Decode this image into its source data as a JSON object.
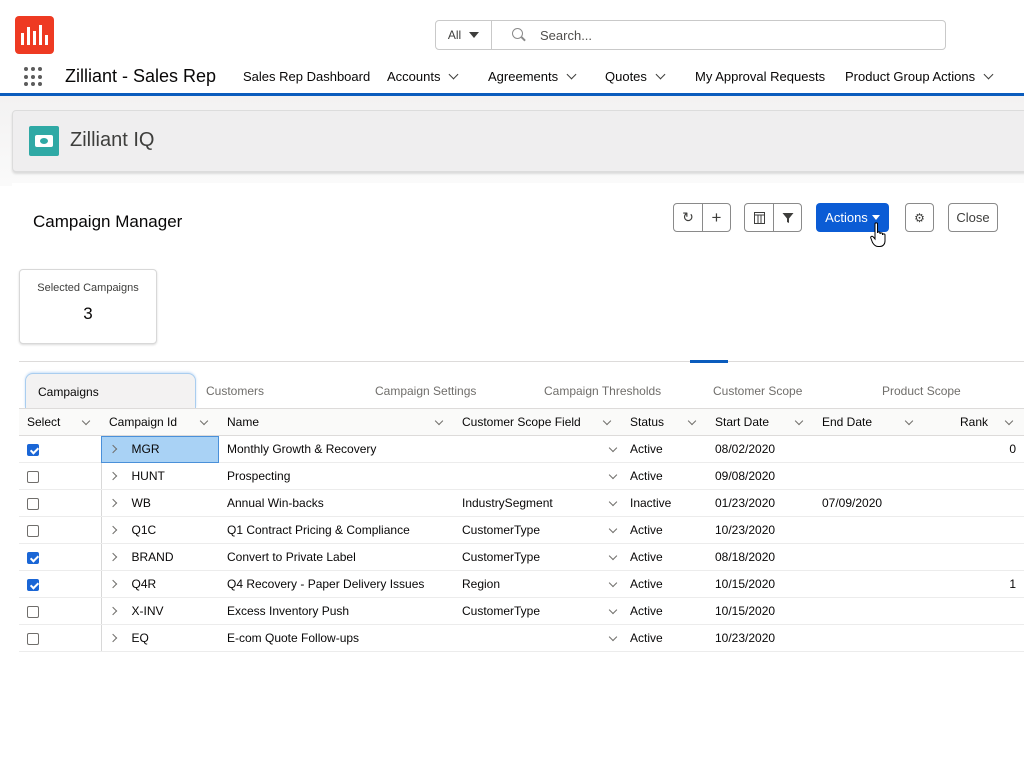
{
  "header": {
    "search": {
      "scope": "All",
      "placeholder": "Search..."
    }
  },
  "nav": {
    "app_name": "Zilliant - Sales Rep",
    "items": [
      {
        "label": "Sales Rep Dashboard",
        "has_menu": false
      },
      {
        "label": "Accounts",
        "has_menu": true
      },
      {
        "label": "Agreements",
        "has_menu": true
      },
      {
        "label": "Quotes",
        "has_menu": true
      },
      {
        "label": "My Approval Requests",
        "has_menu": false
      },
      {
        "label": "Product Group Actions",
        "has_menu": true
      }
    ]
  },
  "app_header": {
    "title": "Zilliant IQ"
  },
  "page": {
    "title": "Campaign Manager",
    "toolbar": {
      "refresh_icon": "refresh-icon",
      "add_icon": "plus-icon",
      "columns_icon": "columns-icon",
      "filter_icon": "filter-icon",
      "actions_label": "Actions",
      "settings_icon": "gear-icon",
      "close_label": "Close"
    },
    "stat": {
      "label": "Selected Campaigns",
      "value": "3"
    }
  },
  "tabs": [
    "Campaigns",
    "Customers",
    "Campaign Settings",
    "Campaign Thresholds",
    "Customer Scope",
    "Product Scope"
  ],
  "active_tab": "Campaigns",
  "table": {
    "columns": [
      "Select",
      "Campaign Id",
      "Name",
      "Customer Scope Field",
      "Status",
      "Start Date",
      "End Date",
      "Rank"
    ],
    "rows": [
      {
        "selected": true,
        "id": "MGR",
        "name": "Monthly Growth & Recovery",
        "scope": "",
        "status": "Active",
        "start": "08/02/2020",
        "end": "",
        "rank": "0"
      },
      {
        "selected": false,
        "id": "HUNT",
        "name": "Prospecting",
        "scope": "",
        "status": "Active",
        "start": "09/08/2020",
        "end": "",
        "rank": ""
      },
      {
        "selected": false,
        "id": "WB",
        "name": "Annual Win-backs",
        "scope": "IndustrySegment",
        "status": "Inactive",
        "start": "01/23/2020",
        "end": "07/09/2020",
        "rank": ""
      },
      {
        "selected": false,
        "id": "Q1C",
        "name": "Q1 Contract Pricing & Compliance",
        "scope": "CustomerType",
        "status": "Active",
        "start": "10/23/2020",
        "end": "",
        "rank": ""
      },
      {
        "selected": true,
        "id": "BRAND",
        "name": "Convert to Private Label",
        "scope": "CustomerType",
        "status": "Active",
        "start": "08/18/2020",
        "end": "",
        "rank": ""
      },
      {
        "selected": true,
        "id": "Q4R",
        "name": "Q4 Recovery - Paper Delivery Issues",
        "scope": "Region",
        "status": "Active",
        "start": "10/15/2020",
        "end": "",
        "rank": "1"
      },
      {
        "selected": false,
        "id": "X-INV",
        "name": "Excess Inventory Push",
        "scope": "CustomerType",
        "status": "Active",
        "start": "10/15/2020",
        "end": "",
        "rank": ""
      },
      {
        "selected": false,
        "id": "EQ",
        "name": "E-com Quote Follow-ups",
        "scope": "",
        "status": "Active",
        "start": "10/23/2020",
        "end": "",
        "rank": ""
      }
    ],
    "highlighted_cell": {
      "row": 0,
      "column": "Campaign Id"
    }
  },
  "colors": {
    "brand_logo": "#ee3a22",
    "nav_accent": "#0b5cbd",
    "primary_button": "#0b5cd5",
    "app_icon": "#2fa9a5",
    "checkbox_checked": "#1a66d6",
    "cell_highlight": "#a9d2f5"
  }
}
